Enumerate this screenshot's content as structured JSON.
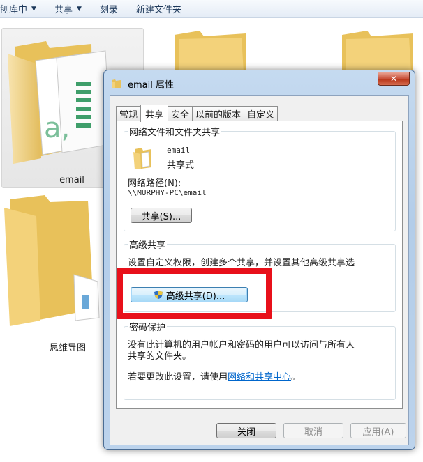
{
  "toolbar": {
    "items": [
      {
        "label": "刨库中",
        "caret": "▼"
      },
      {
        "label": "共享",
        "caret": "▼"
      },
      {
        "label": "刻录",
        "caret": ""
      },
      {
        "label": "新建文件夹",
        "caret": ""
      }
    ]
  },
  "files": {
    "email_label": "email",
    "mind_map_label": "思维导图"
  },
  "dialog": {
    "title": "email 属性",
    "close_glyph": "✕",
    "tabs": [
      "常规",
      "共享",
      "安全",
      "以前的版本",
      "自定义"
    ],
    "active_tab": "共享",
    "network_share": {
      "group_title": "网络文件和文件夹共享",
      "folder_name": "email",
      "share_status": "共享式",
      "path_label": "网络路径(N):",
      "path_value": "\\\\MURPHY-PC\\email",
      "share_button": "共享(S)..."
    },
    "advanced_share": {
      "group_title": "高级共享",
      "description": "设置自定义权限，创建多个共享，并设置其他高级共享选",
      "button": "高级共享(D)..."
    },
    "password": {
      "group_title": "密码保护",
      "line1": "没有此计算机的用户帐户和密码的用户可以访问与所有人",
      "line2": "共享的文件夹。",
      "change_prefix": "若要更改此设置，请使用",
      "link": "网络和共享中心",
      "change_suffix": "。"
    },
    "buttons": {
      "close": "关闭",
      "cancel": "取消",
      "apply": "应用(A)"
    }
  },
  "colors": {
    "highlight": "#e8101a",
    "link": "#0066cc",
    "folder": "#f3d27a"
  }
}
